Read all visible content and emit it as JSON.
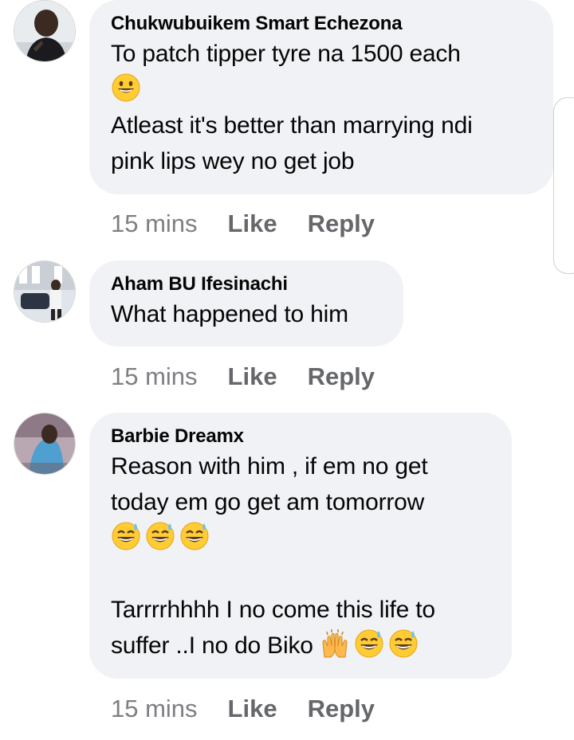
{
  "comments": [
    {
      "author": "Chukwubuikem Smart Echezona",
      "avatar": "avatar-photo",
      "lines": [
        "To patch tipper tyre na 1500 each",
        "Atleast it's better than marrying ndi",
        "pink lips wey no get job"
      ],
      "emojis": [
        "grinning-face"
      ],
      "time": "15 mins",
      "like": "Like",
      "reply": "Reply"
    },
    {
      "author": "Aham BU Ifesinachi",
      "avatar": "avatar-photo",
      "lines": [
        "What happened to him"
      ],
      "time": "15 mins",
      "like": "Like",
      "reply": "Reply"
    },
    {
      "author": "Barbie Dreamx",
      "avatar": "avatar-photo",
      "lines": [
        "Reason with him , if em no get",
        "today em go get am tomorrow",
        "Tarrrrhhhh I no come this life to",
        "suffer ..I no do Biko"
      ],
      "emojis": [
        "grinning-sweat-face",
        "raising-hands",
        "grinning-sweat-face"
      ],
      "time": "15 mins",
      "like": "Like",
      "reply": "Reply"
    }
  ],
  "colors": {
    "bubble": "#f0f2f5",
    "name_text": "#050505",
    "meta_text": "#65676b"
  }
}
